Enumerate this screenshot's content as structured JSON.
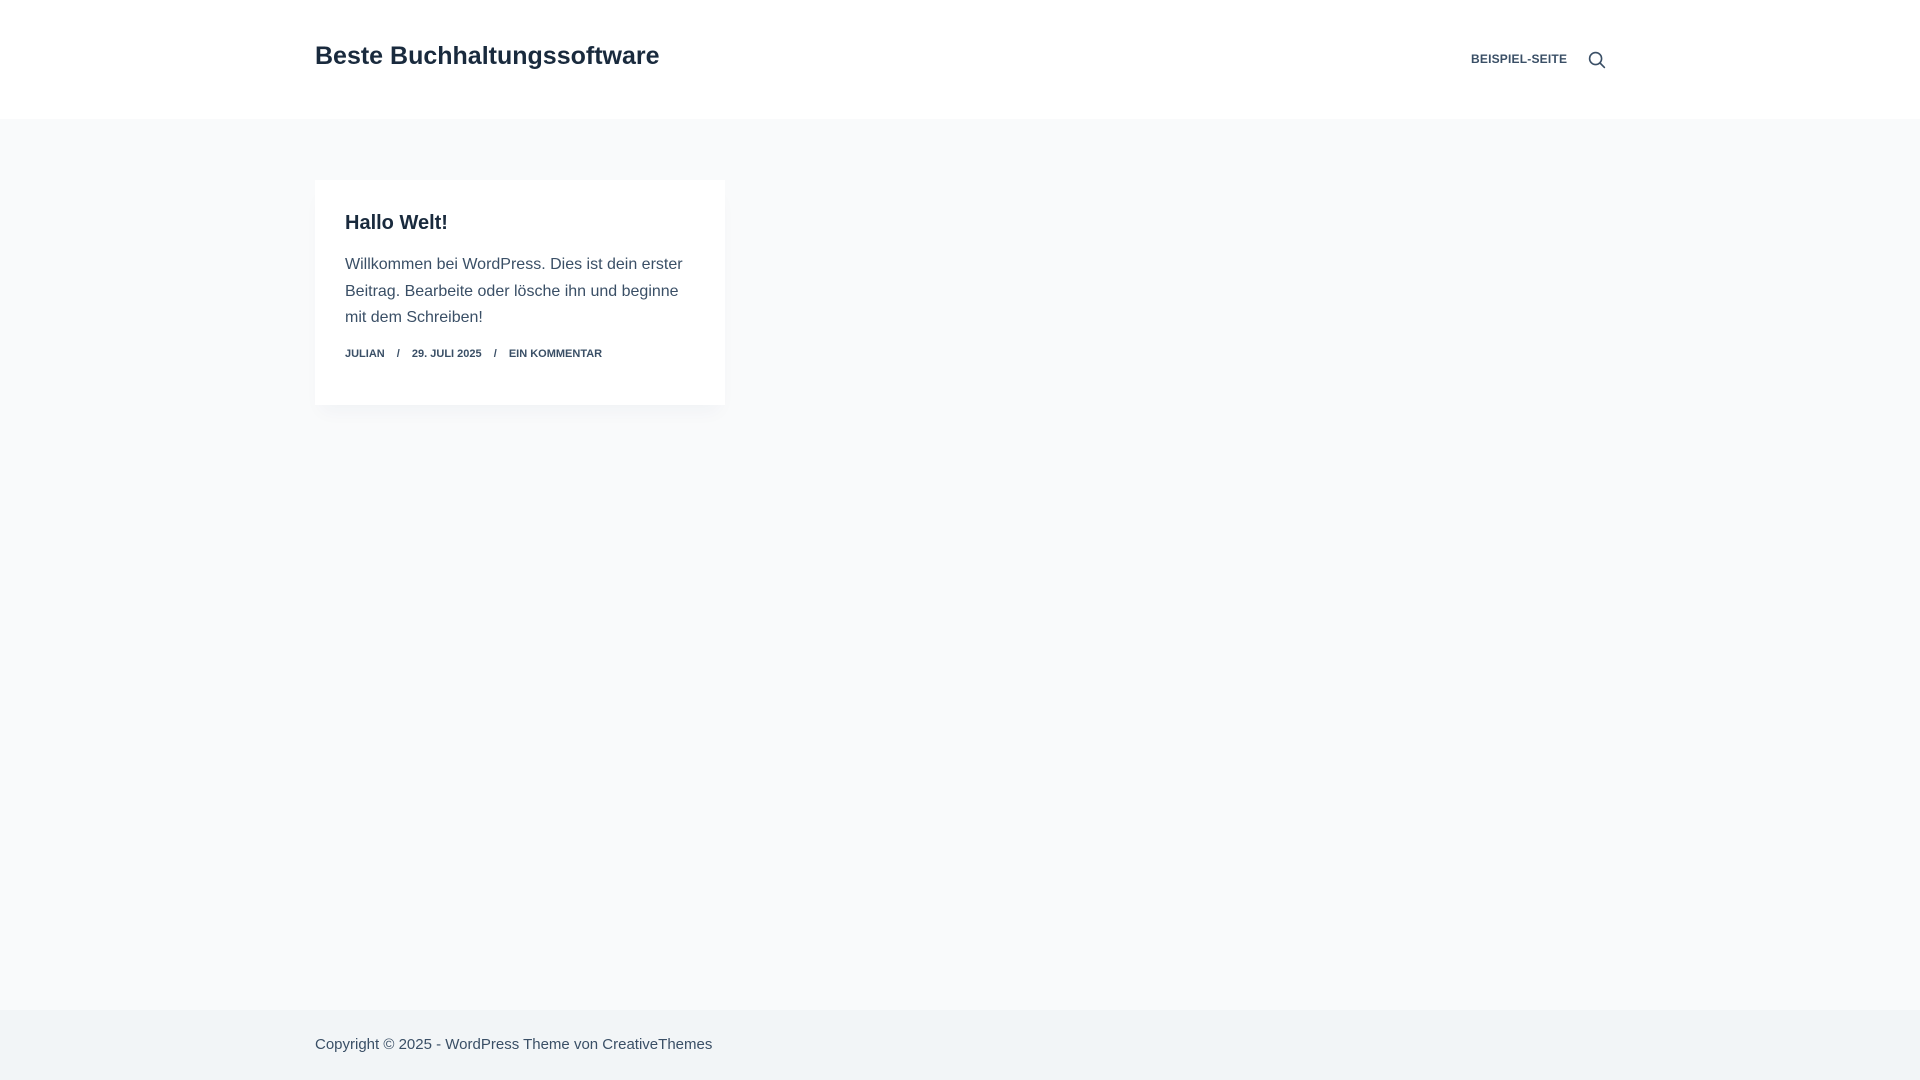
{
  "header": {
    "site_title": "Beste Buchhaltungssoftware",
    "nav_items": [
      {
        "label": "BEISPIEL-SEITE"
      }
    ],
    "search_icon": "search-icon"
  },
  "post": {
    "title": "Hallo Welt!",
    "excerpt": "Willkommen bei WordPress. Dies ist dein erster Beitrag. Bearbeite oder lösche ihn und beginne mit dem Schreiben!",
    "author": "JULIAN",
    "date": "29. JULI 2025",
    "comments": "EIN KOMMENTAR",
    "separator": "/"
  },
  "footer": {
    "copyright_prefix": "Copyright © 2025 - WordPress Theme von ",
    "theme_author": "CreativeThemes"
  },
  "colors": {
    "heading": "#192a3d",
    "text": "#3a4f66",
    "page_background": "#f9fafb",
    "footer_background": "#f2f5f7"
  }
}
